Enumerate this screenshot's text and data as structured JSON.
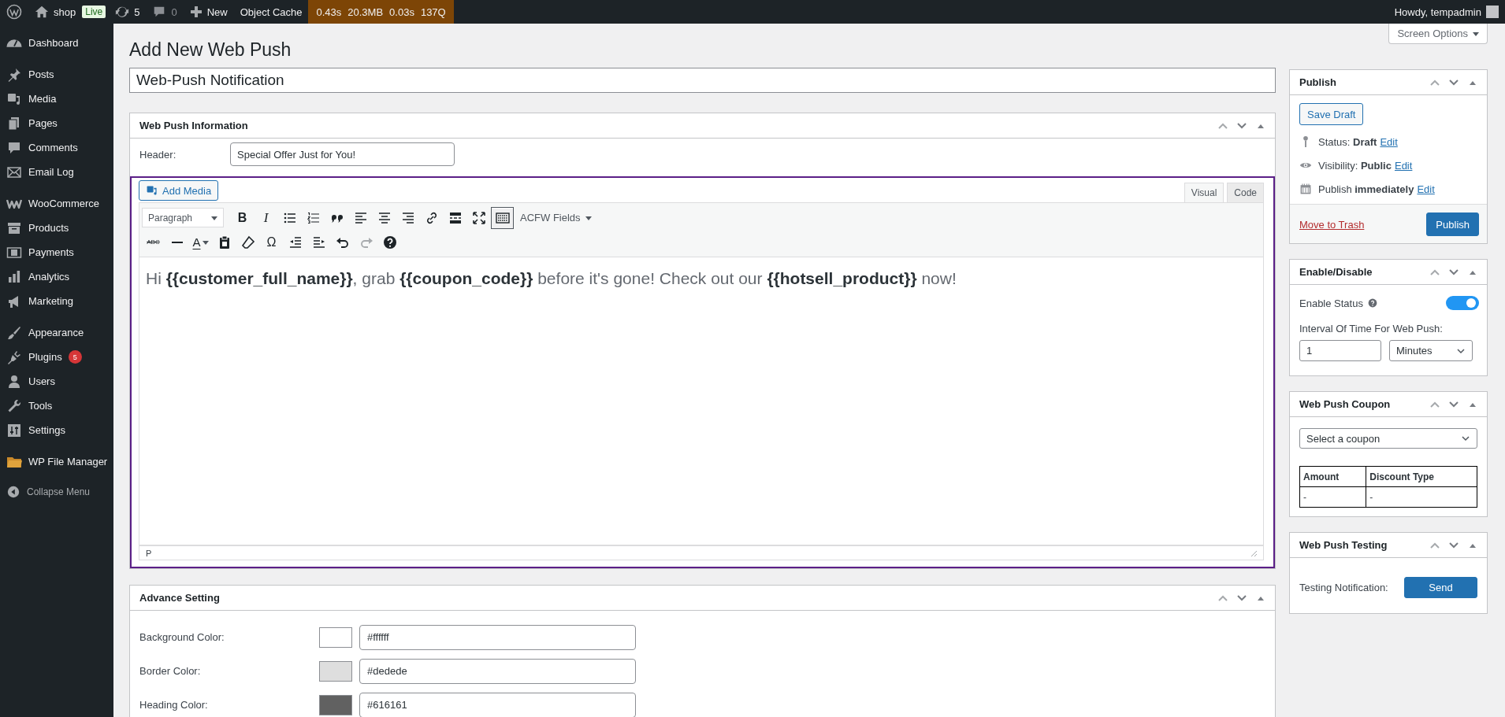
{
  "admin_bar": {
    "site_name": "shop",
    "environment_badge": "Live",
    "updates_count": "5",
    "comments_count": "0",
    "new_label": "New",
    "object_cache_label": "Object Cache",
    "query_monitor": [
      "0.43s",
      "20.3MB",
      "0.03s",
      "137Q"
    ],
    "greeting": "Howdy, tempadmin"
  },
  "sidebar": {
    "groups": [
      [
        {
          "label": "Dashboard",
          "selected": false
        }
      ],
      [
        {
          "label": "Posts",
          "selected": false
        },
        {
          "label": "Media",
          "selected": false
        },
        {
          "label": "Pages",
          "selected": false
        },
        {
          "label": "Comments",
          "selected": false
        },
        {
          "label": "Email Log",
          "selected": false
        }
      ],
      [
        {
          "label": "WooCommerce",
          "selected": false
        },
        {
          "label": "Products",
          "selected": false
        },
        {
          "label": "Payments",
          "selected": false
        },
        {
          "label": "Analytics",
          "selected": false
        },
        {
          "label": "Marketing",
          "selected": false
        }
      ],
      [
        {
          "label": "Appearance",
          "selected": false
        },
        {
          "label": "Plugins",
          "selected": false,
          "badge": "5"
        },
        {
          "label": "Users",
          "selected": false
        },
        {
          "label": "Tools",
          "selected": false
        },
        {
          "label": "Settings",
          "selected": false
        }
      ],
      [
        {
          "label": "WP File Manager",
          "selected": false
        }
      ]
    ],
    "collapse_label": "Collapse Menu"
  },
  "screen_options": "Screen Options",
  "page_title": "Add New Web Push",
  "post_title": {
    "value": "Web-Push Notification"
  },
  "web_push_information": {
    "title": "Web Push Information",
    "header_label": "Header:",
    "header_value": "Special Offer Just for You!",
    "editor": {
      "add_media": "Add Media",
      "tabs": [
        {
          "label": "Visual",
          "selected": true
        },
        {
          "label": "Code",
          "selected": false
        }
      ],
      "toolbar_rows": [
        [
          {
            "kind": "select",
            "label": "Paragraph",
            "pressed": false
          },
          {
            "kind": "bold",
            "label": "B",
            "pressed": false
          },
          {
            "kind": "italic",
            "label": "I",
            "pressed": false
          },
          {
            "kind": "icon",
            "pressed": false
          },
          {
            "kind": "icon",
            "pressed": false
          },
          {
            "kind": "icon",
            "pressed": false
          },
          {
            "kind": "icon",
            "pressed": false
          },
          {
            "kind": "icon",
            "pressed": false
          },
          {
            "kind": "icon",
            "pressed": false
          },
          {
            "kind": "icon",
            "pressed": false
          },
          {
            "kind": "icon",
            "pressed": false
          },
          {
            "kind": "icon",
            "pressed": false
          },
          {
            "kind": "icon",
            "pressed": true
          },
          {
            "kind": "menu",
            "label": "ACFW Fields",
            "pressed": false
          }
        ],
        [
          {
            "kind": "strike",
            "label": "ABC",
            "disabled": false
          },
          {
            "kind": "icon",
            "disabled": false
          },
          {
            "kind": "color",
            "label": "A",
            "disabled": false
          },
          {
            "kind": "icon",
            "disabled": false
          },
          {
            "kind": "icon",
            "disabled": false
          },
          {
            "kind": "char",
            "label": "Ω",
            "disabled": false
          },
          {
            "kind": "icon",
            "disabled": false
          },
          {
            "kind": "icon",
            "disabled": false
          },
          {
            "kind": "icon",
            "disabled": false
          },
          {
            "kind": "icon",
            "disabled": true
          },
          {
            "kind": "icon",
            "disabled": false
          }
        ]
      ],
      "content": "Hi **{{customer_full_name}}**, grab **{{coupon_code}}** before it's gone! Check out our **{{hotsell_product}}** now!",
      "path": "P"
    }
  },
  "advance_setting": {
    "title": "Advance Setting",
    "rows": [
      {
        "label": "Background Color:",
        "color": "#ffffff",
        "value": "#ffffff"
      },
      {
        "label": "Border Color:",
        "color": "#dedede",
        "value": "#dedede"
      },
      {
        "label": "Heading Color:",
        "color": "#616161",
        "value": "#616161"
      }
    ]
  },
  "publish": {
    "title": "Publish",
    "save_draft": "Save Draft",
    "status_lines": [
      {
        "text": "Status: **Draft**",
        "link": "Edit"
      },
      {
        "text": "Visibility: **Public**",
        "link": "Edit"
      },
      {
        "text": "Publish **immediately**",
        "link": "Edit"
      }
    ],
    "trash": "Move to Trash",
    "publish_button": "Publish"
  },
  "enable_disable": {
    "title": "Enable/Disable",
    "status_label": "Enable Status",
    "enabled": true,
    "interval_label": "Interval Of Time For Web Push:",
    "interval_value": "1",
    "interval_unit": "Minutes"
  },
  "coupon": {
    "title": "Web Push Coupon",
    "selected_option": "Select a coupon",
    "columns": [
      "Amount",
      "Discount Type"
    ],
    "rows": [
      [
        "-",
        "-"
      ]
    ]
  },
  "testing": {
    "title": "Web Push Testing",
    "label": "Testing Notification:",
    "send": "Send"
  }
}
